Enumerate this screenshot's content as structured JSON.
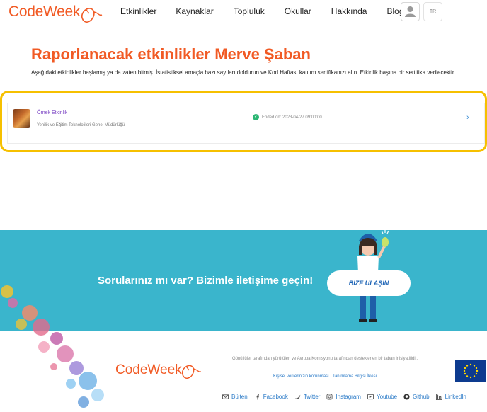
{
  "header": {
    "logo": "CodeWeek",
    "nav": [
      "Etkinlikler",
      "Kaynaklar",
      "Topluluk",
      "Okullar",
      "Hakkında",
      "Blog"
    ],
    "lang": "TR"
  },
  "main": {
    "title": "Raporlanacak etkinlikler Merve Şaban",
    "intro": "Aşağıdaki etkinlikler başlamış ya da zaten bitmiş. İstatistiksel amaçla bazı sayıları doldurun ve Kod Haftası katılım sertifikanızı alın. Etkinlik başına bir sertifika verilecektir.",
    "event": {
      "name": "Örnek Etkinlik",
      "organizer": "Yenilik ve Eğitim Teknolojileri Genel Müdürlüğü",
      "status": "Ended on: 2023-04-27 09:00:00"
    }
  },
  "contact": {
    "text": "Sorularınız mı var? Bizimle iletişime geçin!",
    "button": "BİZE ULAŞIN"
  },
  "footer": {
    "logo": "CodeWeek",
    "text": "Gönüllüler tarafından yürütülen ve Avrupa Komisyonu tarafından desteklenen bir taban inisiyatifidir.",
    "links": "Kişisel verilerinizin korunması · Tanımlama Bilgisi İlkesi",
    "social": [
      "Bülten",
      "Facebook",
      "Twitter",
      "Instagram",
      "Youtube",
      "Github",
      "LinkedIn"
    ]
  },
  "colors": {
    "brand": "#f15a24",
    "band": "#3ab5cc",
    "highlight": "#f6c000",
    "link": "#2a7ac7"
  }
}
